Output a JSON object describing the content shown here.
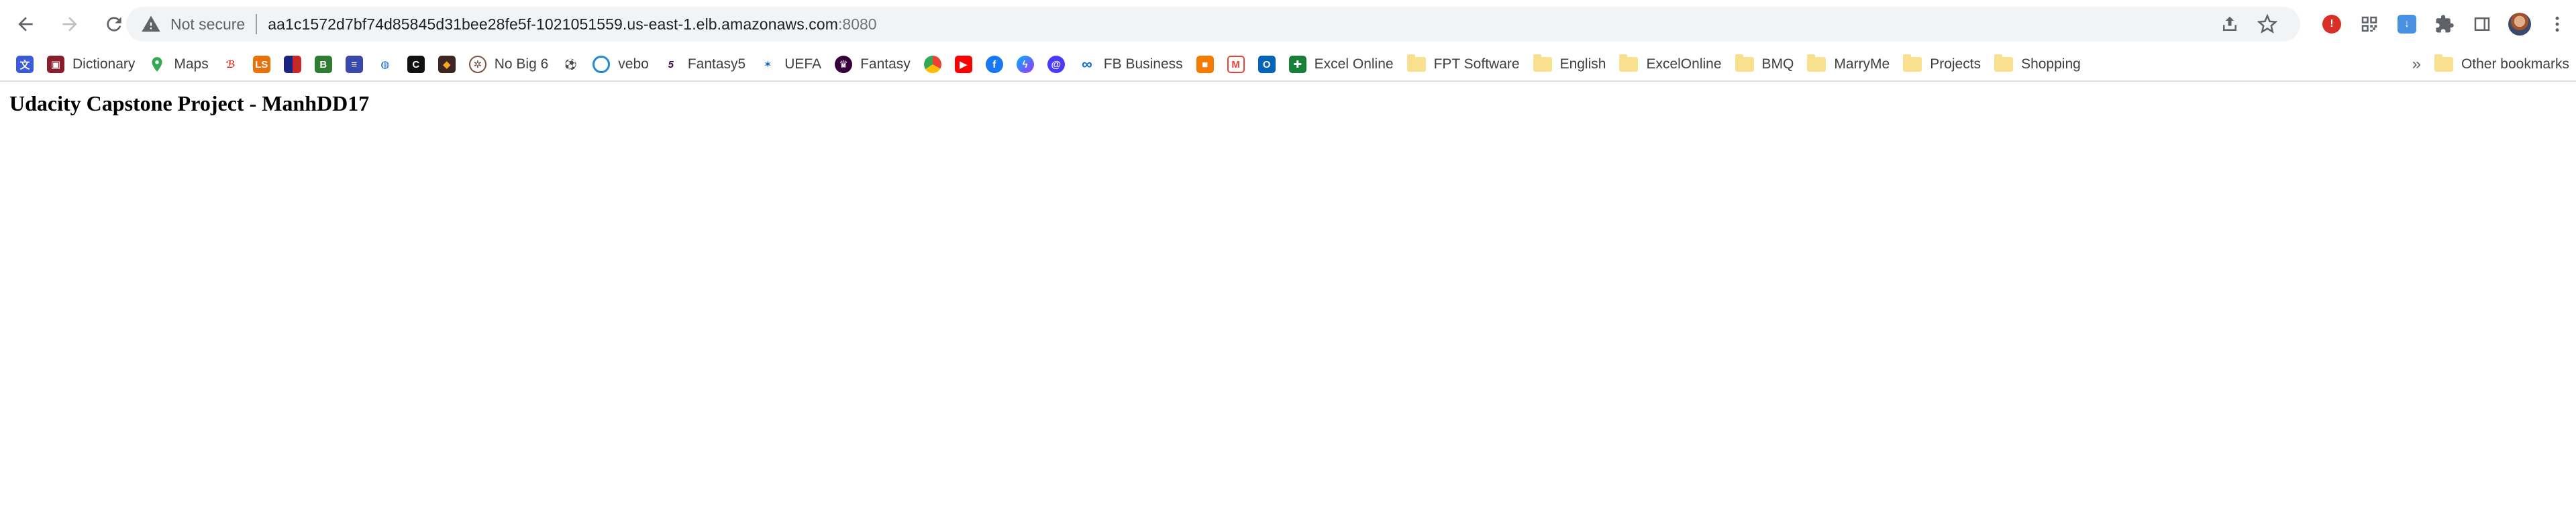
{
  "omnibox": {
    "security_label": "Not secure",
    "host": "aa1c1572d7bf74d85845d31bee28fe5f-1021051559.us-east-1.elb.amazonaws.com",
    "port": ":8080"
  },
  "bookmarks": {
    "items": [
      {
        "label": "Dictionary"
      },
      {
        "label": "Maps"
      },
      {
        "label": "No Big 6"
      },
      {
        "label": "vebo"
      },
      {
        "label": "Fantasy5"
      },
      {
        "label": "UEFA"
      },
      {
        "label": "Fantasy"
      },
      {
        "label": "FB Business"
      },
      {
        "label": "Excel Online"
      }
    ],
    "folders": [
      {
        "label": "FPT Software"
      },
      {
        "label": "English"
      },
      {
        "label": "ExcelOnline"
      },
      {
        "label": "BMQ"
      },
      {
        "label": "MarryMe"
      },
      {
        "label": "Projects"
      },
      {
        "label": "Shopping"
      }
    ],
    "overflow": "»",
    "other": "Other bookmarks"
  },
  "page": {
    "title": "Udacity Capstone Project - ManhDD17"
  },
  "colors": {
    "accent": "#1a73e8",
    "toolbar_bg": "#ffffff",
    "omnibox_bg": "#f1f3f4",
    "folder": "#f8e08e"
  }
}
